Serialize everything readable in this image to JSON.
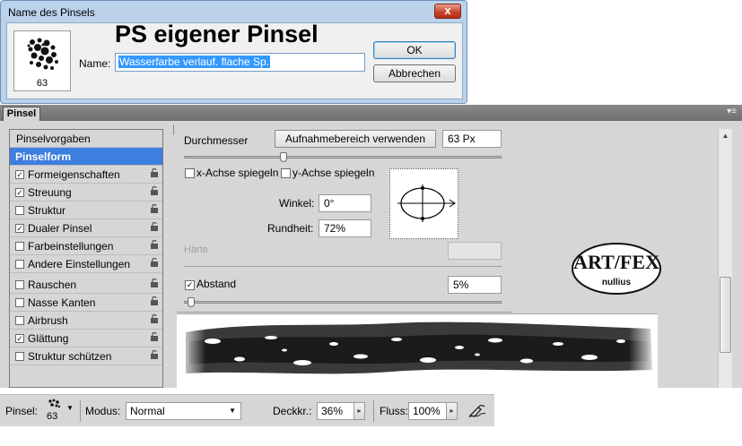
{
  "dialog": {
    "title": "Name des Pinsels",
    "close_glyph": "x",
    "heading": "PS eigener Pinsel",
    "brush_size": "63",
    "name_label": "Name:",
    "name_value": "Wasserfarbe verlauf. flache Sp.",
    "ok_label": "OK",
    "cancel_label": "Abbrechen"
  },
  "panel": {
    "tab_label": "Pinsel",
    "menu_glyph": "▾≡",
    "list": [
      {
        "label": "Pinselvorgaben",
        "type": "header"
      },
      {
        "label": "Pinselform",
        "type": "selected"
      },
      {
        "label": "Formeigenschaften",
        "checked": true,
        "lock": true
      },
      {
        "label": "Streuung",
        "checked": true,
        "lock": true
      },
      {
        "label": "Struktur",
        "checked": false,
        "lock": true
      },
      {
        "label": "Dualer Pinsel",
        "checked": true,
        "lock": true
      },
      {
        "label": "Farbeinstellungen",
        "checked": false,
        "lock": true
      },
      {
        "label": "Andere Einstellungen",
        "checked": false,
        "lock": true
      },
      {
        "label": "Rauschen",
        "checked": false,
        "lock": true
      },
      {
        "label": "Nasse Kanten",
        "checked": false,
        "lock": true
      },
      {
        "label": "Airbrush",
        "checked": false,
        "lock": true
      },
      {
        "label": "Glättung",
        "checked": true,
        "lock": true
      },
      {
        "label": "Struktur schützen",
        "checked": false,
        "lock": true
      }
    ],
    "diameter_label": "Durchmesser",
    "sample_button": "Aufnahmebereich verwenden",
    "diameter_value": "63 Px",
    "flip_x_label": "x-Achse spiegeln",
    "flip_y_label": "y-Achse spiegeln",
    "angle_label": "Winkel:",
    "angle_value": "0°",
    "roundness_label": "Rundheit:",
    "roundness_value": "72%",
    "hardness_label": "Härte",
    "spacing_label": "Abstand",
    "spacing_checked": true,
    "spacing_value": "5%",
    "logo_text_top": "ART/FEX",
    "logo_text_bottom": "nullius"
  },
  "optionsbar": {
    "brush_label": "Pinsel:",
    "brush_size": "63",
    "mode_label": "Modus:",
    "mode_value": "Normal",
    "opacity_label": "Deckkr.:",
    "opacity_value": "36%",
    "flow_label": "Fluss:",
    "flow_value": "100%"
  },
  "icons": {
    "lock": "lock-icon",
    "airbrush": "airbrush-icon",
    "dropdown": "chevron-down-icon"
  }
}
